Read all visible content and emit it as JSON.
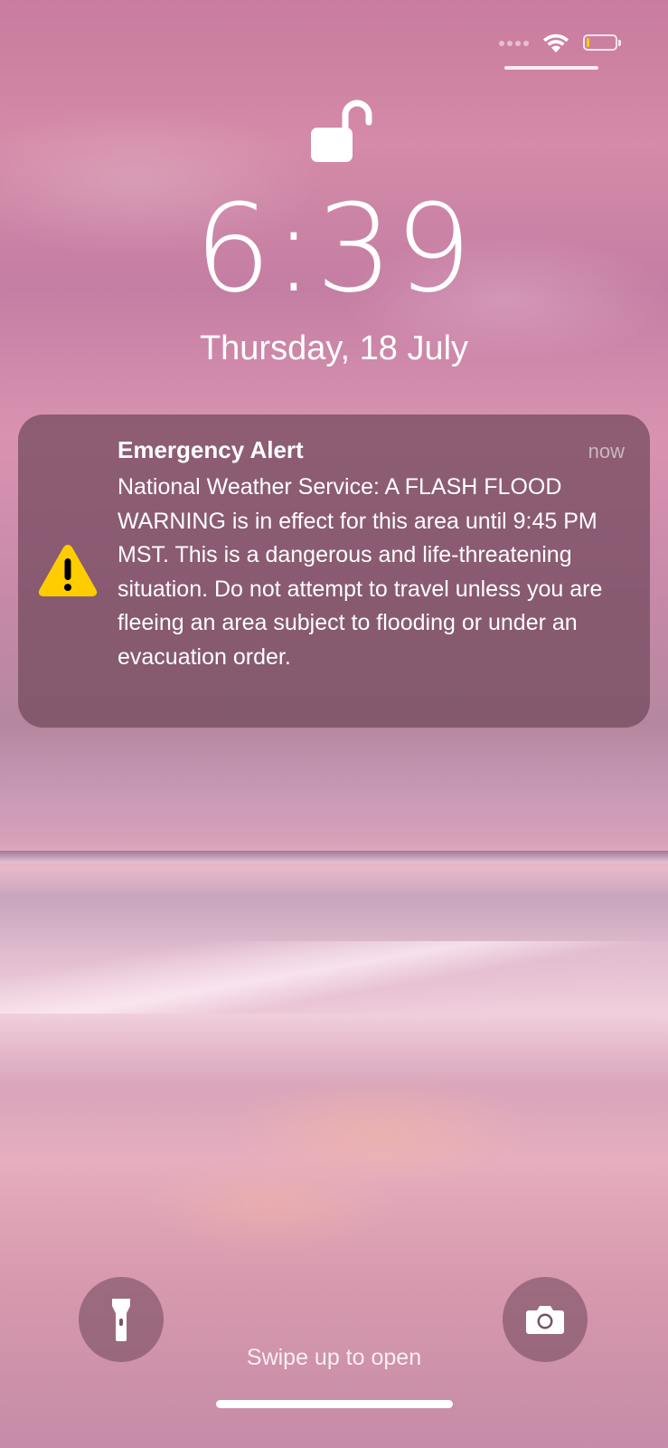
{
  "lock_screen": {
    "time": "6:39",
    "date": "Thursday, 18 July",
    "swipe_hint": "Swipe up to open"
  },
  "status_bar": {
    "wifi_icon": "wifi-icon",
    "battery_level": 0.1,
    "battery_color": "#ffcc00"
  },
  "notification": {
    "title": "Emergency Alert",
    "timestamp": "now",
    "body": "National Weather Service: A FLASH FLOOD WARNING is in effect for this area until 9:45 PM MST. This is a dangerous and life-threatening situation. Do not attempt to travel unless you are fleeing an area subject to flooding or under an evacuation order.",
    "icon": "warning-triangle-icon",
    "icon_color": "#ffcc00"
  },
  "quick_actions": {
    "left_icon": "flashlight-icon",
    "right_icon": "camera-icon"
  }
}
